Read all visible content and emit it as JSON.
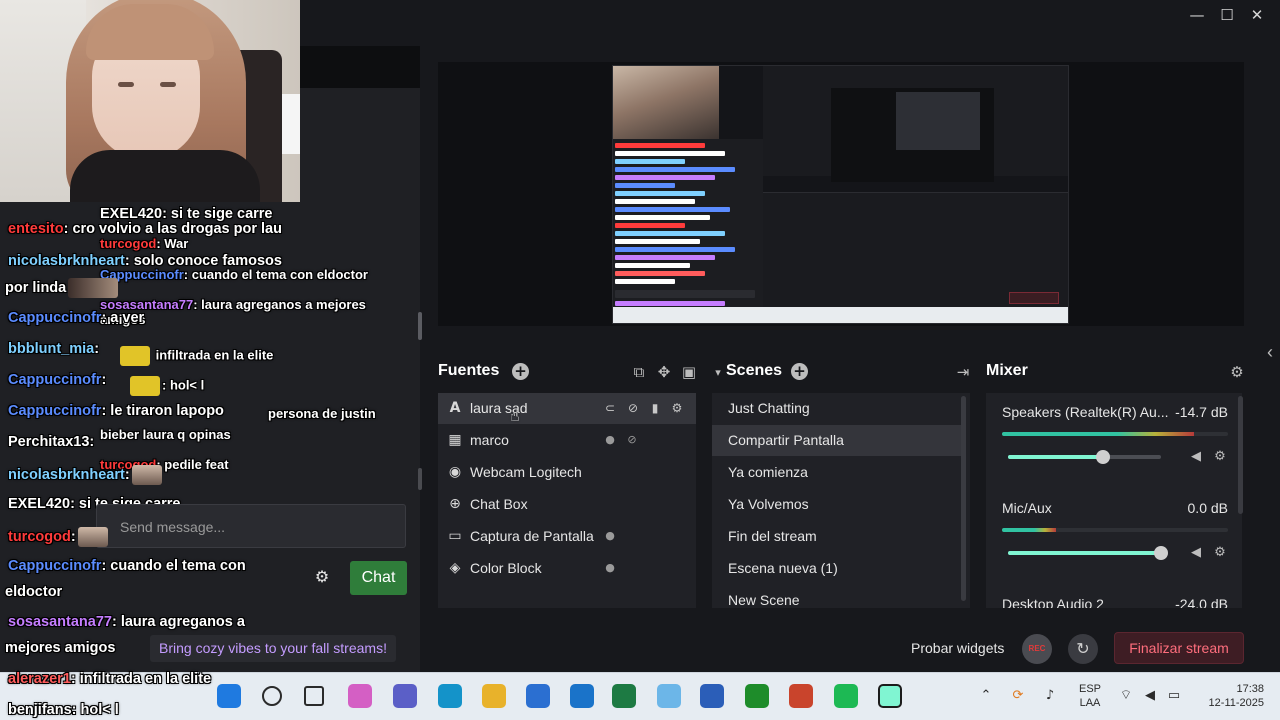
{
  "window": {
    "controls": {
      "minimize": "—",
      "maximize": "☐",
      "close": "✕"
    }
  },
  "sources": {
    "title": "Fuentes",
    "items": [
      {
        "label": "laura sad",
        "icon": "text-icon",
        "selected": true
      },
      {
        "label": "marco",
        "icon": "image-icon"
      },
      {
        "label": "Webcam Logitech",
        "icon": "webcam-icon"
      },
      {
        "label": "Chat Box",
        "icon": "globe-icon"
      },
      {
        "label": "Captura de Pantalla",
        "icon": "monitor-icon"
      },
      {
        "label": "Color Block",
        "icon": "paint-bucket-icon"
      }
    ]
  },
  "scenes": {
    "title": "Scenes",
    "items": [
      {
        "label": "Just Chatting"
      },
      {
        "label": "Compartir Pantalla",
        "selected": true
      },
      {
        "label": "Ya comienza"
      },
      {
        "label": "Ya Volvemos"
      },
      {
        "label": "Fin del stream"
      },
      {
        "label": "Escena nueva (1)"
      },
      {
        "label": "New Scene"
      }
    ]
  },
  "mixer": {
    "title": "Mixer",
    "channels": [
      {
        "name": "Speakers (Realtek(R) Au...",
        "db": "-14.7 dB",
        "level": 0.85,
        "volume": 0.62
      },
      {
        "name": "Mic/Aux",
        "db": "0.0 dB",
        "level": 0.24,
        "volume": 1.0
      },
      {
        "name": "Desktop Audio 2",
        "db": "-24.0 dB"
      }
    ]
  },
  "bottom": {
    "test_widgets": "Probar widgets",
    "rec": "REC",
    "end_stream": "Finalizar stream"
  },
  "chat": {
    "lines": [
      {
        "user": "EXEL420",
        "text": ": si te sige carre",
        "color": "#ffffff"
      },
      {
        "user": "entesito",
        "text": ": cro volvio a las drogas por lau",
        "color": "#ff3b3b"
      },
      {
        "user": "turcogod",
        "text": ": War",
        "color": "#ff3b3b"
      },
      {
        "user": "nicolasbrknheart",
        "text": ": solo conoce famosos",
        "color": "#7fd0ff"
      },
      {
        "user": "Cappuccinofr",
        "text": ": cuando el tema con eldoctor",
        "color": "#5b8cff"
      },
      {
        "user": "",
        "text": "por linda",
        "color": "#ffffff"
      },
      {
        "user": "sosasantana77",
        "text": ": laura agreganos a mejores",
        "color": "#c57dff"
      },
      {
        "user": "",
        "text": "amigos",
        "color": "#ffffff"
      },
      {
        "user": "Cappuccinofr",
        "text": ": a ver",
        "color": "#5b8cff"
      },
      {
        "user": "bbblunt_mia",
        "text": ":",
        "color": "#7fd0ff"
      },
      {
        "user": "",
        "text": "infiltrada en la elite",
        "color": "#ffffff"
      },
      {
        "user": "Cappuccinofr",
        "text": ":",
        "color": "#5b8cff"
      },
      {
        "user": "benjifans",
        "text": ": hol< l",
        "color": "#ffffff"
      },
      {
        "user": "Cappuccinofr",
        "text": ": le tiraron lapopo",
        "color": "#5b8cff"
      },
      {
        "user": "",
        "text": "persona de justin",
        "color": "#ffffff"
      },
      {
        "user": "Perchitax13",
        "text": ":",
        "color": "#ffffff"
      },
      {
        "user": "",
        "text": "bieber laura q opinas",
        "color": "#ffffff"
      },
      {
        "user": "turcogod",
        "text": ": pedile feat",
        "color": "#ff3b3b"
      },
      {
        "user": "nicolasbrknheart",
        "text": ":",
        "color": "#7fd0ff"
      },
      {
        "user": "EXEL420",
        "text": ": si te sige carre",
        "color": "#ffffff"
      },
      {
        "user": "turcogod",
        "text": ":",
        "color": "#ff3b3b"
      },
      {
        "user": "Cappuccinofr",
        "text": ": cuando el tema con",
        "color": "#5b8cff"
      },
      {
        "user": "",
        "text": "eldoctor",
        "color": "#ffffff"
      },
      {
        "user": "sosasantana77",
        "text": ": laura agreganos a",
        "color": "#c57dff"
      },
      {
        "user": "",
        "text": "mejores amigos",
        "color": "#ffffff"
      },
      {
        "user": "alerazer1",
        "text": ": infiltrada en la elite",
        "color": "#ff5c5c"
      },
      {
        "user": "benjifans",
        "text": ": hol< l",
        "color": "#ffffff"
      }
    ],
    "send_placeholder": "Send message...",
    "chat_button": "Chat",
    "promo": "Bring cozy vibes to your fall streams!"
  },
  "taskbar": {
    "lang_top": "ESP",
    "lang_bottom": "LAA",
    "time": "17:38",
    "date": "12-11-2025",
    "apps": [
      "windows-start-icon",
      "search-icon",
      "task-view-icon",
      "copilot-icon",
      "teams-icon",
      "edge-icon",
      "file-explorer-icon",
      "store-icon",
      "mail-icon",
      "excel-icon",
      "photos-icon",
      "word-icon",
      "xbox-icon",
      "powerpoint-icon",
      "spotify-icon",
      "streamlabs-icon"
    ]
  }
}
